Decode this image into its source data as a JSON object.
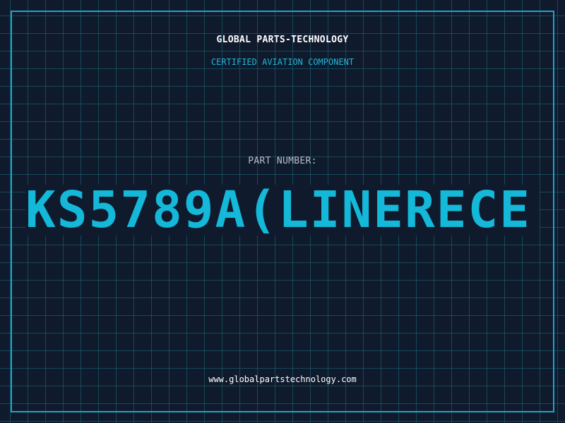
{
  "header": {
    "company": "GLOBAL PARTS-TECHNOLOGY",
    "tagline": "CERTIFIED AVIATION COMPONENT"
  },
  "part": {
    "label": "PART NUMBER:",
    "number": "KS5789A(LINERECE"
  },
  "footer": {
    "url": "www.globalpartstechnology.com"
  },
  "colors": {
    "background": "#101a2d",
    "grid": "#1b6e7d",
    "frame": "#1ea4c8",
    "accent": "#14b8d8",
    "title": "#ffffff",
    "label": "#b8bfcc"
  }
}
